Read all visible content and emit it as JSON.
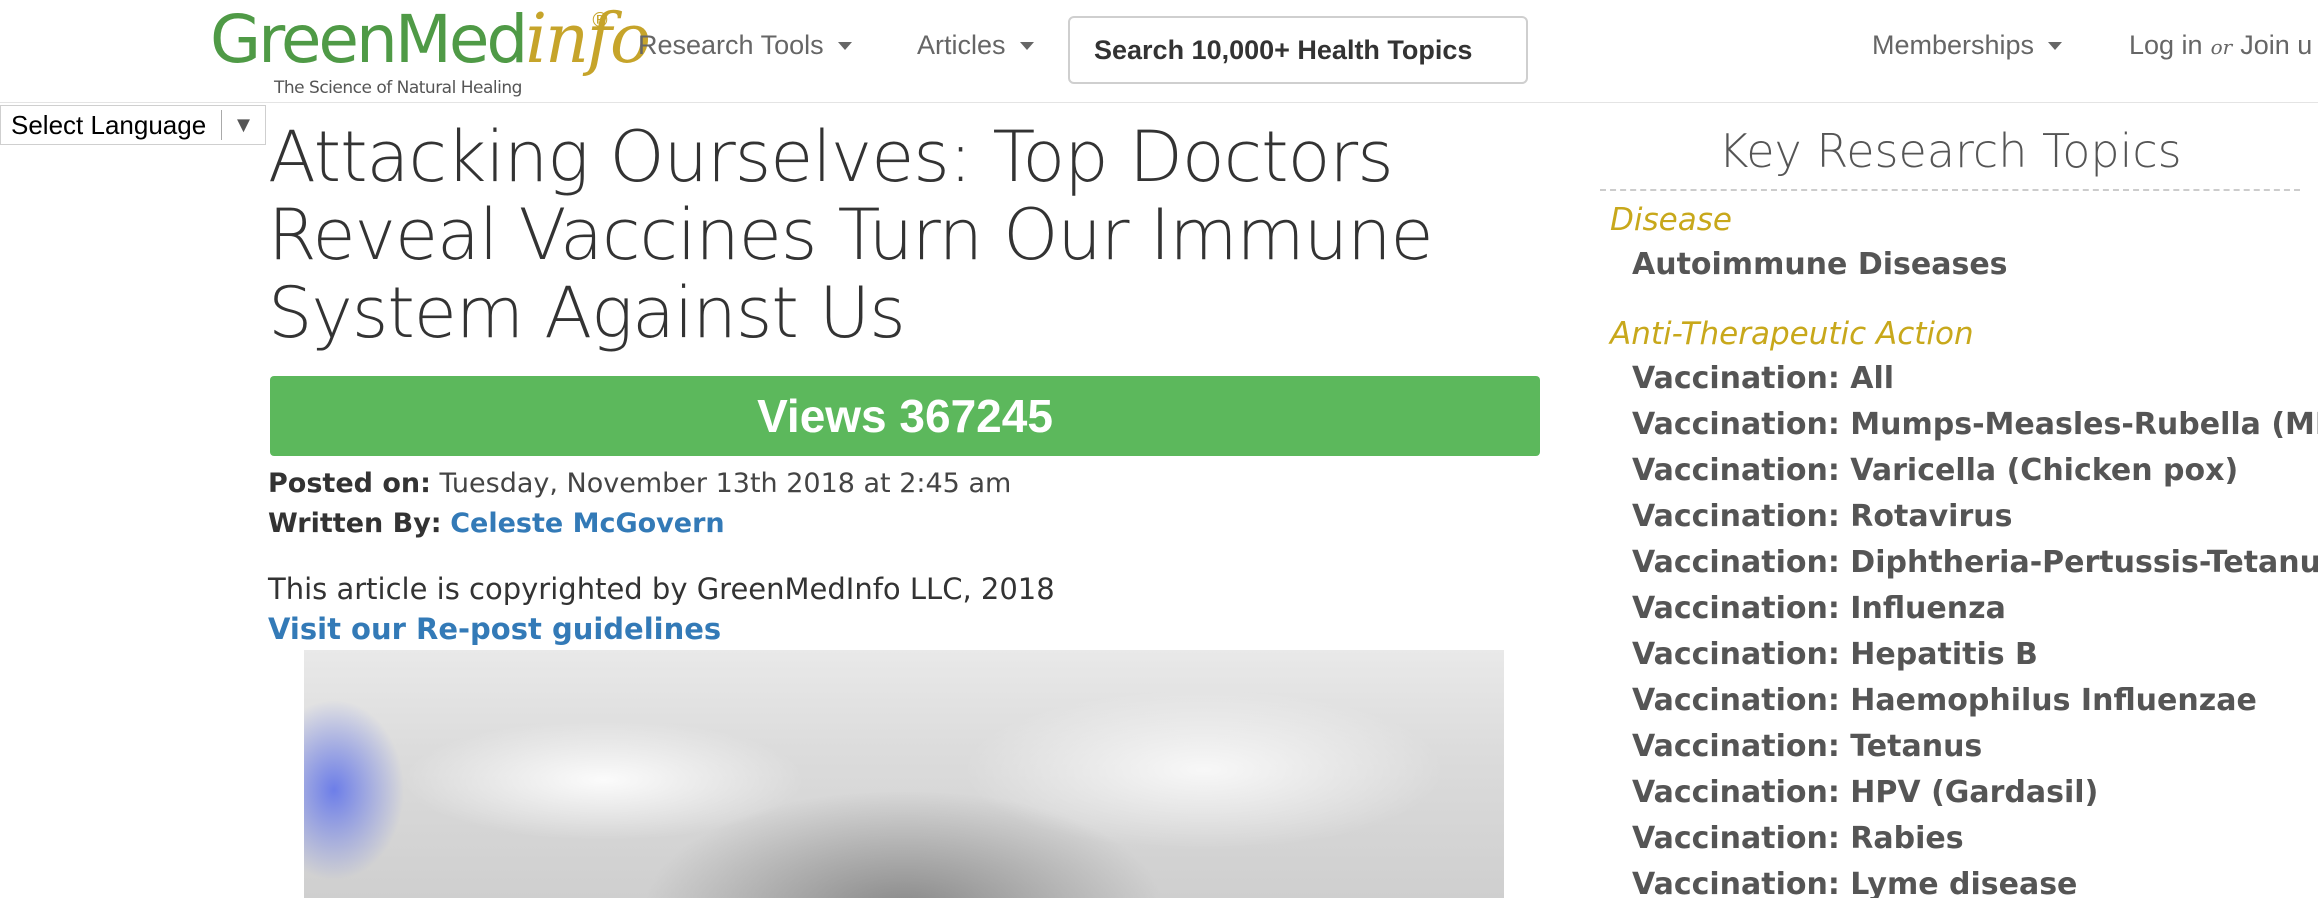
{
  "logo": {
    "word_green": "GreenMed",
    "word_gold": "info",
    "registered": "®",
    "tagline": "The Science of Natural Healing"
  },
  "nav": {
    "research_tools": "Research Tools",
    "articles": "Articles",
    "search": "Search 10,000+ Health Topics",
    "memberships": "Memberships",
    "login": "Log in",
    "or": "or",
    "join": "Join u"
  },
  "language": {
    "label": "Select Language",
    "arrow": "▼"
  },
  "article": {
    "title": "Attacking Ourselves: Top Doctors Reveal Vaccines Turn Our Immune System Against Us",
    "views": "Views 367245",
    "posted_label": "Posted on:",
    "posted_value": "Tuesday, November 13th 2018 at 2:45 am",
    "written_label": "Written By:",
    "author": "Celeste McGovern",
    "copyright": "This article is copyrighted by GreenMedInfo LLC, 2018",
    "repost": "Visit our Re-post guidelines"
  },
  "sidebar": {
    "title": "Key Research Topics",
    "groups": [
      {
        "category": "Disease",
        "topics": [
          "Autoimmune Diseases"
        ]
      },
      {
        "category": "Anti-Therapeutic Action",
        "topics": [
          "Vaccination: All",
          "Vaccination: Mumps-Measles-Rubella (MMR)",
          "Vaccination: Varicella (Chicken pox)",
          "Vaccination: Rotavirus",
          "Vaccination: Diphtheria-Pertussis-Tetanus",
          "Vaccination: Influenza",
          "Vaccination: Hepatitis B",
          "Vaccination: Haemophilus Influenzae",
          "Vaccination: Tetanus",
          "Vaccination: HPV (Gardasil)",
          "Vaccination: Rabies",
          "Vaccination: Lyme disease"
        ]
      }
    ]
  },
  "colors": {
    "brand_green": "#4f9a46",
    "brand_gold": "#c6a42a",
    "views_bar": "#5cb85c",
    "link_blue": "#337ab7"
  }
}
